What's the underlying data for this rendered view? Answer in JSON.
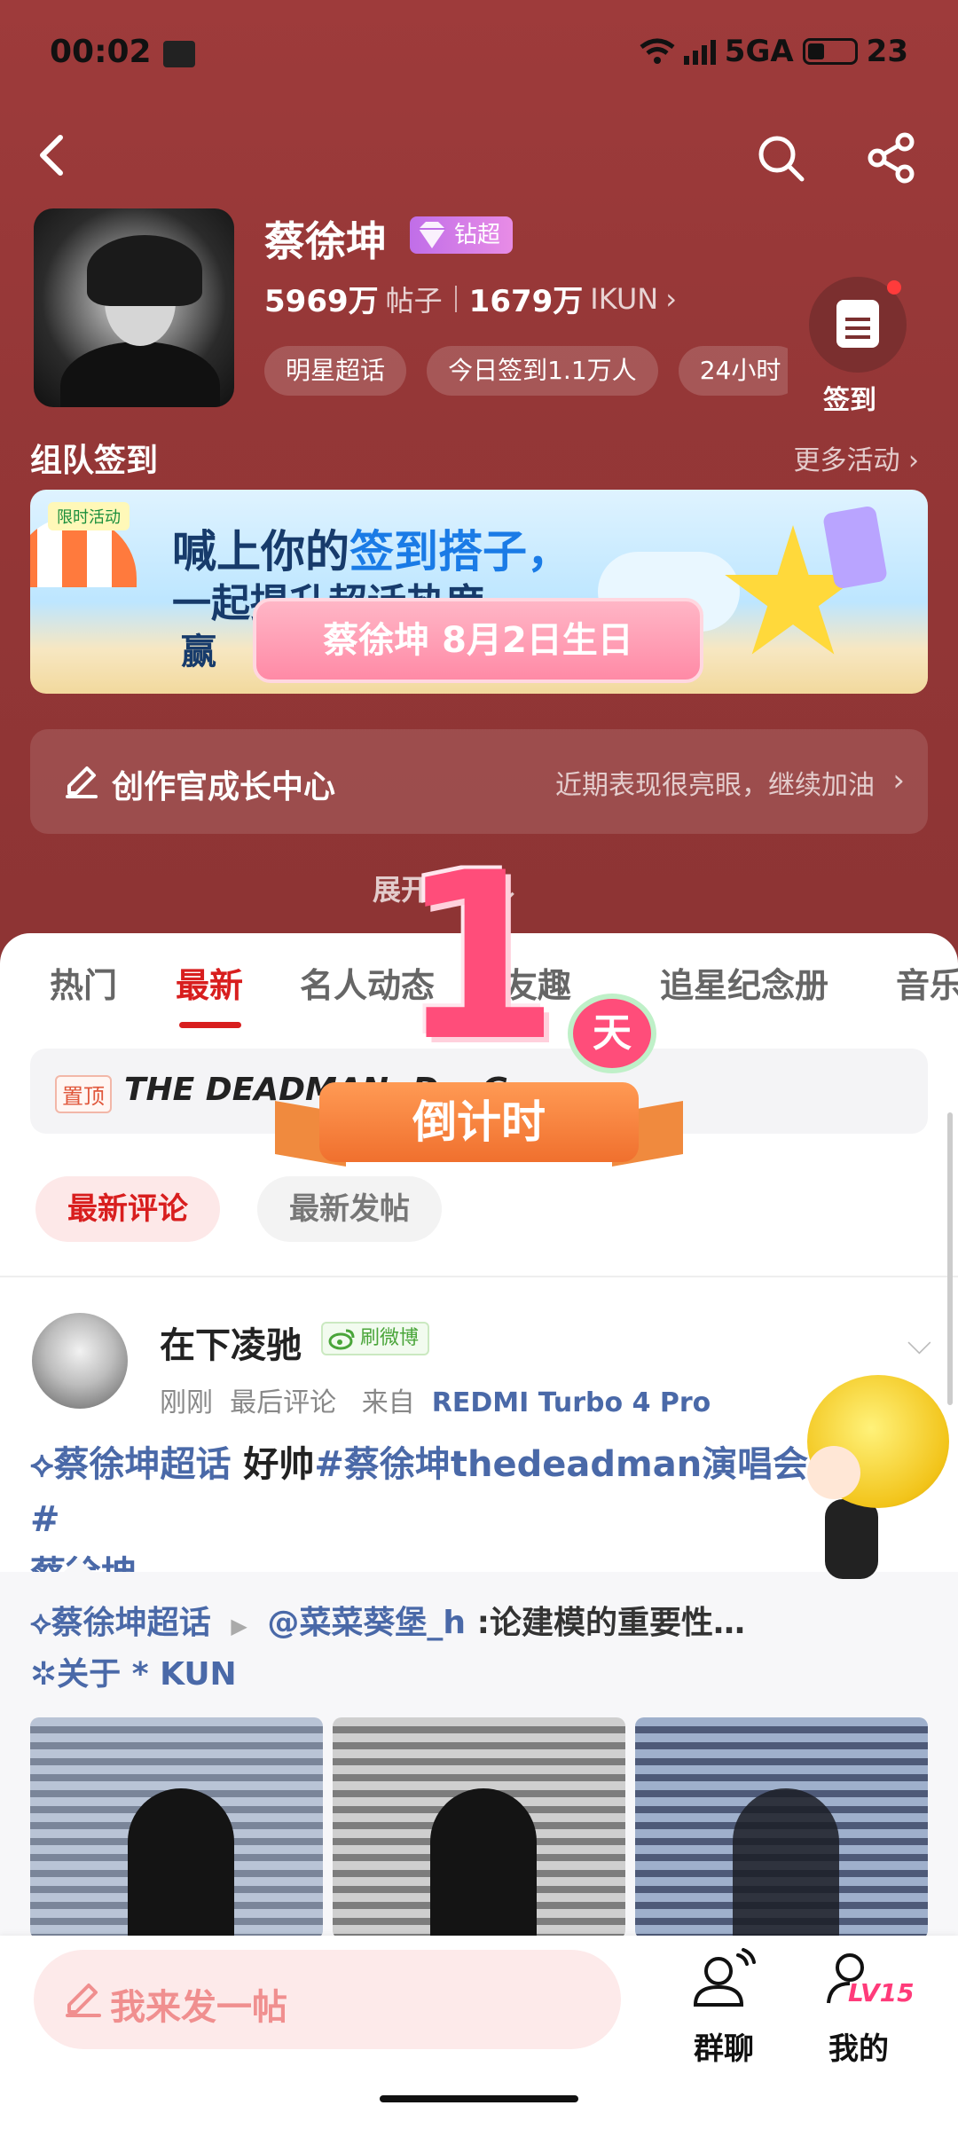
{
  "status": {
    "time": "00:02",
    "network": "5GA",
    "battery": "23"
  },
  "profile": {
    "name": "蔡徐坤",
    "badge": "钻超",
    "posts_count": "5969万",
    "posts_unit": "帖子",
    "fans_count": "1679万",
    "fans_unit": "IKUN",
    "chips": [
      "明星超话",
      "今日签到1.1万人",
      "24小时"
    ],
    "checkin_label": "签到"
  },
  "team": {
    "title": "组队签到",
    "more": "更多活动",
    "banner_tag": "限时活动",
    "banner_line1_a": "喊上你的",
    "banner_line1_b": "签到搭子，",
    "banner_line2": "一起提升超话热度",
    "banner_line3": "赢",
    "birthday": "蔡徐坤  8月2日生日"
  },
  "creator": {
    "title": "创作官成长中心",
    "subtitle": "近期表现很亮眼，继续加油"
  },
  "expand_label": "展开更多",
  "tabs": [
    "热门",
    "最新",
    "名人动态",
    "超友趣",
    "追星纪念册",
    "音乐"
  ],
  "active_tab": "最新",
  "pinned": {
    "tag": "置顶",
    "text": "THE DEADMAN: D… G…"
  },
  "filters": {
    "latest_comment": "最新评论",
    "latest_post": "最新发帖"
  },
  "countdown": {
    "number": "1",
    "unit": "天",
    "label": "倒计时"
  },
  "post": {
    "author": "在下凌驰",
    "source_badge": "刷微博",
    "time": "刚刚",
    "meta_mid": "最后评论",
    "from": "来自",
    "device": "REDMI Turbo 4 Pro",
    "body_link1": "蔡徐坤超话",
    "body_text": "好帅",
    "body_link2": "#蔡徐坤thedeadman演唱会#",
    "body_link3": "蔡徐坤",
    "repost_topic": "蔡徐坤超话",
    "repost_user": "@菜菜葵堡_h",
    "repost_text": ":论建模的重要性…",
    "repost_line2": "关于 * KUN"
  },
  "bottom": {
    "compose": "我来发一帖",
    "group_chat": "群聊",
    "mine": "我的",
    "level": "LV15"
  },
  "colors": {
    "hero": "#953737",
    "accent": "#d81e1e",
    "link": "#4a69a8",
    "compose_bg": "#fdeaea"
  }
}
